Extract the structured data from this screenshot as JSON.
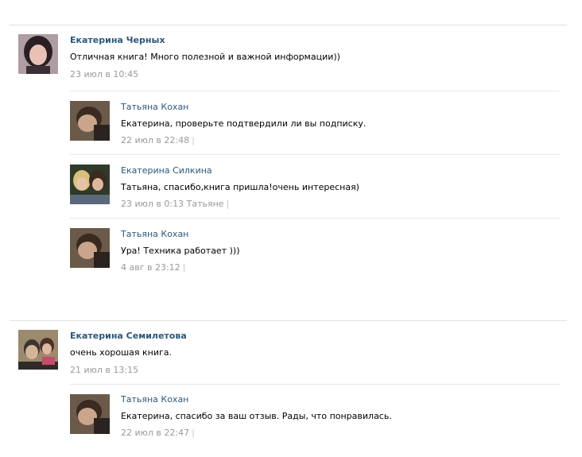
{
  "threads": [
    {
      "author": "Екатерина Черных",
      "text": "Отличная книга! Много полезной и важной информации))",
      "date": "23 июл в 10:45",
      "replies": [
        {
          "author": "Татьяна Кохан",
          "text": "Екатерина, проверьте подтвердили ли вы подписку.",
          "date": "22 июл в 22:48",
          "reply_to": ""
        },
        {
          "author": "Екатерина Силкина",
          "text": "Татьяна, спасибо,книга пришла!очень интересная)",
          "date": "23 июл в 0:13",
          "reply_to": "Татьяне"
        },
        {
          "author": "Татьяна Кохан",
          "text": "Ура! Техника работает )))",
          "date": "4 авг в 23:12",
          "reply_to": ""
        }
      ]
    },
    {
      "author": "Екатерина Семилетова",
      "text": "очень хорошая книга.",
      "date": "21 июл в 13:15",
      "replies": [
        {
          "author": "Татьяна Кохан",
          "text": "Екатерина, спасибо за ваш отзыв. Рады, что понравилась.",
          "date": "22 июл в 22:47",
          "reply_to": ""
        }
      ]
    }
  ],
  "separator": "|",
  "colors": {
    "link": "#2b587a",
    "meta": "#999999",
    "divider": "#dae1e8"
  }
}
